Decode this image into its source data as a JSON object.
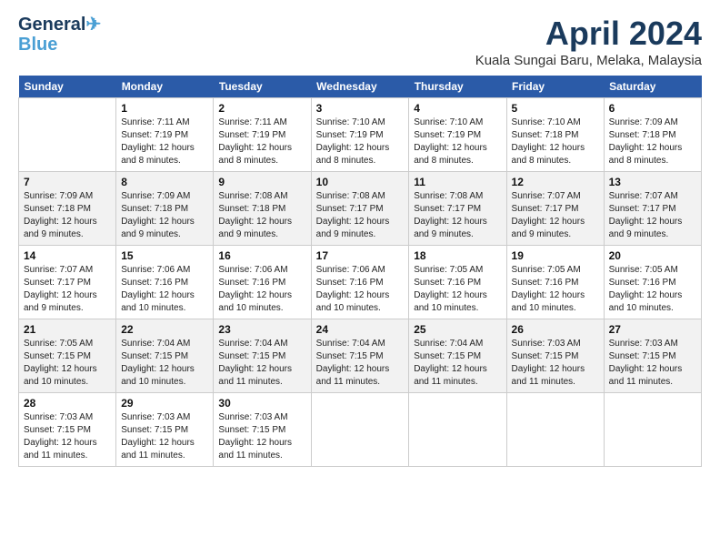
{
  "header": {
    "logo_line1": "General",
    "logo_line2": "Blue",
    "month": "April 2024",
    "location": "Kuala Sungai Baru, Melaka, Malaysia"
  },
  "days_of_week": [
    "Sunday",
    "Monday",
    "Tuesday",
    "Wednesday",
    "Thursday",
    "Friday",
    "Saturday"
  ],
  "weeks": [
    [
      {
        "day": "",
        "info": ""
      },
      {
        "day": "1",
        "info": "Sunrise: 7:11 AM\nSunset: 7:19 PM\nDaylight: 12 hours\nand 8 minutes."
      },
      {
        "day": "2",
        "info": "Sunrise: 7:11 AM\nSunset: 7:19 PM\nDaylight: 12 hours\nand 8 minutes."
      },
      {
        "day": "3",
        "info": "Sunrise: 7:10 AM\nSunset: 7:19 PM\nDaylight: 12 hours\nand 8 minutes."
      },
      {
        "day": "4",
        "info": "Sunrise: 7:10 AM\nSunset: 7:19 PM\nDaylight: 12 hours\nand 8 minutes."
      },
      {
        "day": "5",
        "info": "Sunrise: 7:10 AM\nSunset: 7:18 PM\nDaylight: 12 hours\nand 8 minutes."
      },
      {
        "day": "6",
        "info": "Sunrise: 7:09 AM\nSunset: 7:18 PM\nDaylight: 12 hours\nand 8 minutes."
      }
    ],
    [
      {
        "day": "7",
        "info": "Sunrise: 7:09 AM\nSunset: 7:18 PM\nDaylight: 12 hours\nand 9 minutes."
      },
      {
        "day": "8",
        "info": "Sunrise: 7:09 AM\nSunset: 7:18 PM\nDaylight: 12 hours\nand 9 minutes."
      },
      {
        "day": "9",
        "info": "Sunrise: 7:08 AM\nSunset: 7:18 PM\nDaylight: 12 hours\nand 9 minutes."
      },
      {
        "day": "10",
        "info": "Sunrise: 7:08 AM\nSunset: 7:17 PM\nDaylight: 12 hours\nand 9 minutes."
      },
      {
        "day": "11",
        "info": "Sunrise: 7:08 AM\nSunset: 7:17 PM\nDaylight: 12 hours\nand 9 minutes."
      },
      {
        "day": "12",
        "info": "Sunrise: 7:07 AM\nSunset: 7:17 PM\nDaylight: 12 hours\nand 9 minutes."
      },
      {
        "day": "13",
        "info": "Sunrise: 7:07 AM\nSunset: 7:17 PM\nDaylight: 12 hours\nand 9 minutes."
      }
    ],
    [
      {
        "day": "14",
        "info": "Sunrise: 7:07 AM\nSunset: 7:17 PM\nDaylight: 12 hours\nand 9 minutes."
      },
      {
        "day": "15",
        "info": "Sunrise: 7:06 AM\nSunset: 7:16 PM\nDaylight: 12 hours\nand 10 minutes."
      },
      {
        "day": "16",
        "info": "Sunrise: 7:06 AM\nSunset: 7:16 PM\nDaylight: 12 hours\nand 10 minutes."
      },
      {
        "day": "17",
        "info": "Sunrise: 7:06 AM\nSunset: 7:16 PM\nDaylight: 12 hours\nand 10 minutes."
      },
      {
        "day": "18",
        "info": "Sunrise: 7:05 AM\nSunset: 7:16 PM\nDaylight: 12 hours\nand 10 minutes."
      },
      {
        "day": "19",
        "info": "Sunrise: 7:05 AM\nSunset: 7:16 PM\nDaylight: 12 hours\nand 10 minutes."
      },
      {
        "day": "20",
        "info": "Sunrise: 7:05 AM\nSunset: 7:16 PM\nDaylight: 12 hours\nand 10 minutes."
      }
    ],
    [
      {
        "day": "21",
        "info": "Sunrise: 7:05 AM\nSunset: 7:15 PM\nDaylight: 12 hours\nand 10 minutes."
      },
      {
        "day": "22",
        "info": "Sunrise: 7:04 AM\nSunset: 7:15 PM\nDaylight: 12 hours\nand 10 minutes."
      },
      {
        "day": "23",
        "info": "Sunrise: 7:04 AM\nSunset: 7:15 PM\nDaylight: 12 hours\nand 11 minutes."
      },
      {
        "day": "24",
        "info": "Sunrise: 7:04 AM\nSunset: 7:15 PM\nDaylight: 12 hours\nand 11 minutes."
      },
      {
        "day": "25",
        "info": "Sunrise: 7:04 AM\nSunset: 7:15 PM\nDaylight: 12 hours\nand 11 minutes."
      },
      {
        "day": "26",
        "info": "Sunrise: 7:03 AM\nSunset: 7:15 PM\nDaylight: 12 hours\nand 11 minutes."
      },
      {
        "day": "27",
        "info": "Sunrise: 7:03 AM\nSunset: 7:15 PM\nDaylight: 12 hours\nand 11 minutes."
      }
    ],
    [
      {
        "day": "28",
        "info": "Sunrise: 7:03 AM\nSunset: 7:15 PM\nDaylight: 12 hours\nand 11 minutes."
      },
      {
        "day": "29",
        "info": "Sunrise: 7:03 AM\nSunset: 7:15 PM\nDaylight: 12 hours\nand 11 minutes."
      },
      {
        "day": "30",
        "info": "Sunrise: 7:03 AM\nSunset: 7:15 PM\nDaylight: 12 hours\nand 11 minutes."
      },
      {
        "day": "",
        "info": ""
      },
      {
        "day": "",
        "info": ""
      },
      {
        "day": "",
        "info": ""
      },
      {
        "day": "",
        "info": ""
      }
    ]
  ]
}
